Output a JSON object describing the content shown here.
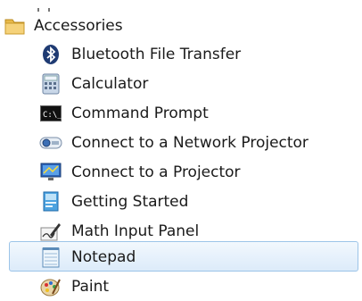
{
  "menu": {
    "folder": {
      "label": "Accessories",
      "icon": "folder-icon"
    },
    "items": [
      {
        "label": "Bluetooth File Transfer",
        "icon": "bluetooth-icon"
      },
      {
        "label": "Calculator",
        "icon": "calculator-icon"
      },
      {
        "label": "Command Prompt",
        "icon": "command-prompt-icon"
      },
      {
        "label": "Connect to a Network Projector",
        "icon": "network-projector-icon"
      },
      {
        "label": "Connect to a Projector",
        "icon": "projector-icon"
      },
      {
        "label": "Getting Started",
        "icon": "getting-started-icon"
      },
      {
        "label": "Math Input Panel",
        "icon": "math-input-icon"
      },
      {
        "label": "Notepad",
        "icon": "notepad-icon",
        "selected": true
      },
      {
        "label": "Paint",
        "icon": "paint-icon"
      }
    ]
  }
}
